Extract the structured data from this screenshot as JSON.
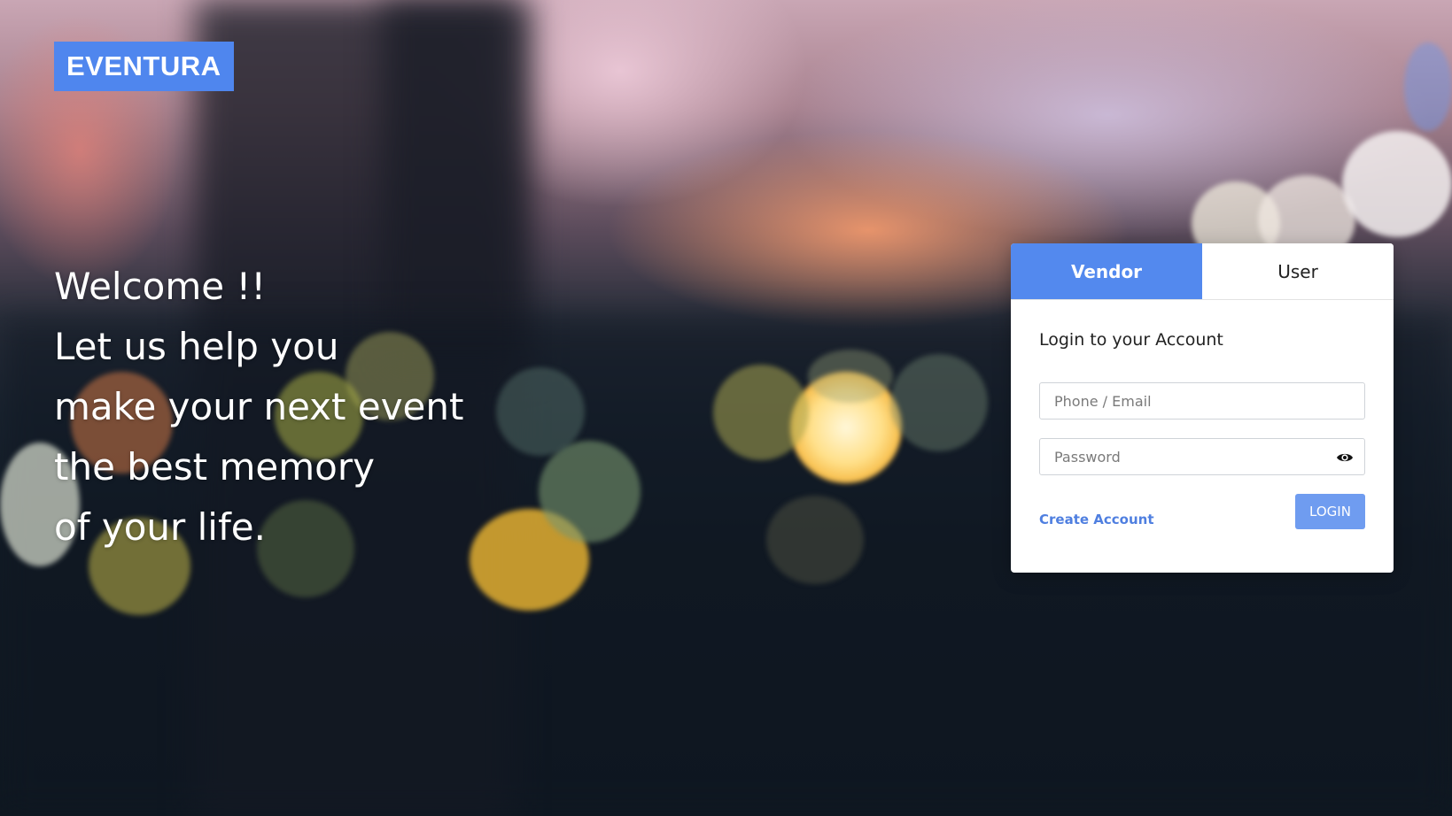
{
  "brand": {
    "name": "EVENTURA"
  },
  "hero": {
    "lines": [
      "Welcome !!",
      "Let us help you",
      "make your next event",
      "the best memory",
      "of your life."
    ]
  },
  "login": {
    "tabs": [
      {
        "label": "Vendor",
        "active": true
      },
      {
        "label": "User",
        "active": false
      }
    ],
    "title": "Login to your Account",
    "fields": {
      "identifier": {
        "placeholder": "Phone / Email",
        "value": ""
      },
      "password": {
        "placeholder": "Password",
        "value": ""
      }
    },
    "password_toggle_icon": "eye-icon",
    "create_account_label": "Create Account",
    "login_label": "LOGIN"
  },
  "colors": {
    "accent": "#5389ee",
    "brand_bg": "#4f86ee",
    "link": "#4f7fe0",
    "button": "#6f9cf0"
  }
}
